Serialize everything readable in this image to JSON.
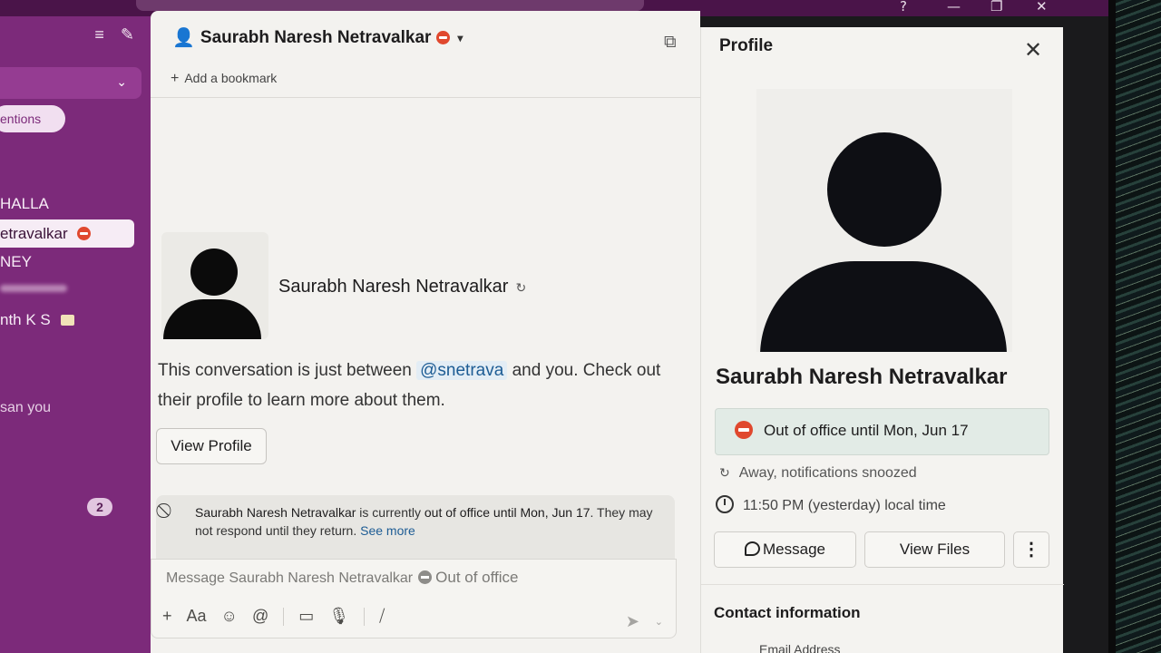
{
  "app": {
    "window_controls": [
      "?",
      "—",
      "❐",
      "✕"
    ]
  },
  "sidebar": {
    "mentions_pill": "entions",
    "items": [
      {
        "label": "HALLA"
      },
      {
        "label": "etravalkar"
      },
      {
        "label": "NEY"
      },
      {
        "label": "nth K S"
      },
      {
        "label": "san  you"
      }
    ],
    "unread_count": "2"
  },
  "conversation": {
    "title": "Saurabh Naresh Netravalkar",
    "add_bookmark": "Add a bookmark",
    "intro_name": "Saurabh Naresh Netravalkar",
    "intro_text_before": "This conversation is just between ",
    "intro_mention": "@snetrava",
    "intro_text_after": " and you. Check out their profile to learn more about them.",
    "view_profile_label": "View Profile",
    "ooo_banner": {
      "name": "Saurabh Naresh Netravalkar",
      "mid": " is currently ",
      "status": "out of office until Mon, Jun 17",
      "rest": ". They may not respond until they return. ",
      "see_more": "See more"
    },
    "composer": {
      "placeholder": "Message Saurabh Naresh Netravalkar",
      "status_hint": "Out of office"
    }
  },
  "profile": {
    "title": "Profile",
    "name": "Saurabh Naresh Netravalkar",
    "status_text": "Out of office until Mon, Jun 17",
    "presence": "Away, notifications snoozed",
    "local_time": "11:50 PM (yesterday) local time",
    "message_label": "Message",
    "view_files_label": "View Files",
    "contact_heading": "Contact information",
    "email_label": "Email Address"
  },
  "colors": {
    "sidebar": "#7c2a7a",
    "dnd": "#e0482e",
    "status_bg": "#e2ebe6",
    "link": "#1d5c94"
  }
}
